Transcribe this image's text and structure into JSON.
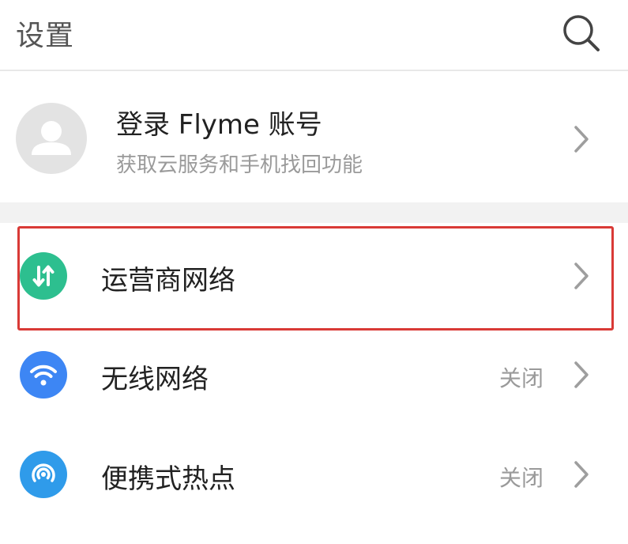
{
  "header": {
    "title": "设置",
    "search_icon": "search-icon"
  },
  "account": {
    "title": "登录 Flyme 账号",
    "subtitle": "获取云服务和手机找回功能",
    "avatar_icon": "person-icon"
  },
  "rows": [
    {
      "label": "运营商网络",
      "status": "",
      "icon": "mobile-data-icon",
      "icon_color": "#2dbf8f"
    },
    {
      "label": "无线网络",
      "status": "关闭",
      "icon": "wifi-icon",
      "icon_color": "#3d86f4"
    },
    {
      "label": "便携式热点",
      "status": "关闭",
      "icon": "hotspot-icon",
      "icon_color": "#2f9bea"
    }
  ],
  "colors": {
    "highlight": "#d93a36",
    "chevron": "#9e9e9e",
    "divider": "#e8e8e8",
    "section_gap": "#f2f2f2"
  }
}
